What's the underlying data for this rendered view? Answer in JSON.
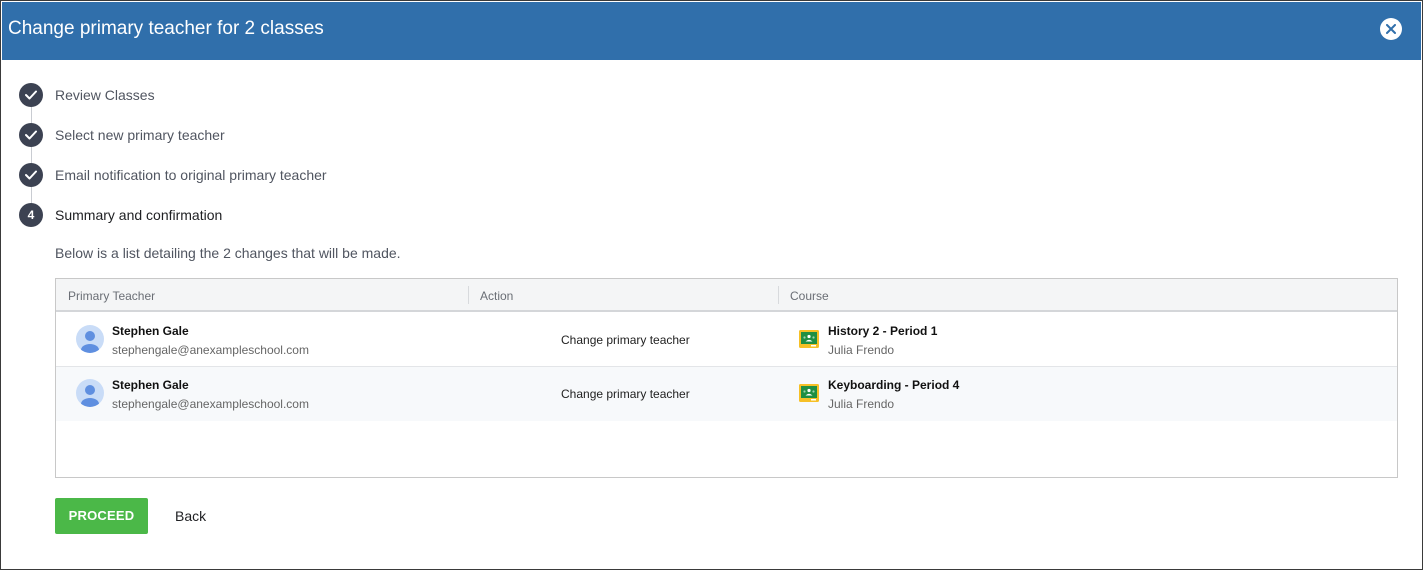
{
  "dialog": {
    "title": "Change primary teacher for 2 classes",
    "close_icon": "close-icon"
  },
  "steps": [
    {
      "label": "Review Classes",
      "status": "complete"
    },
    {
      "label": "Select new primary teacher",
      "status": "complete"
    },
    {
      "label": "Email notification to original primary teacher",
      "status": "complete"
    },
    {
      "label": "Summary and confirmation",
      "status": "current",
      "number": "4"
    }
  ],
  "summary": {
    "text": "Below is a list detailing the 2 changes that will be made."
  },
  "table": {
    "columns": [
      "Primary Teacher",
      "Action",
      "Course"
    ],
    "rows": [
      {
        "teacher_name": "Stephen Gale",
        "teacher_email": "stephengale@anexampleschool.com",
        "action": "Change primary teacher",
        "course_name": "History 2 - Period 1",
        "course_teacher": "Julia Frendo"
      },
      {
        "teacher_name": "Stephen Gale",
        "teacher_email": "stephengale@anexampleschool.com",
        "action": "Change primary teacher",
        "course_name": "Keyboarding - Period 4",
        "course_teacher": "Julia Frendo"
      }
    ]
  },
  "buttons": {
    "proceed": "PROCEED",
    "back": "Back"
  },
  "colors": {
    "header": "#306fab",
    "proceed": "#4bb848",
    "step_circle": "#3c4252"
  }
}
